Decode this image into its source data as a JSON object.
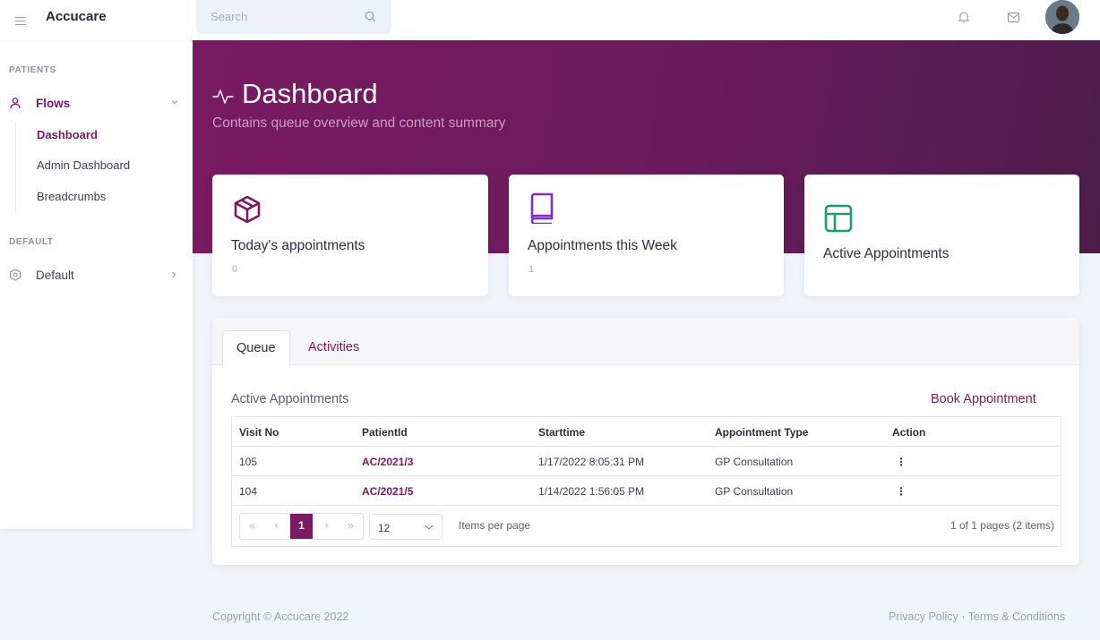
{
  "header": {
    "brand": "Accucare",
    "search_placeholder": "Search"
  },
  "sidebar": {
    "sections": [
      {
        "title": "PATIENTS",
        "item": {
          "label": "Flows",
          "icon": "user-icon"
        },
        "sub_items": [
          "Dashboard",
          "Admin Dashboard",
          "Breadcrumbs"
        ]
      },
      {
        "title": "DEFAULT",
        "item": {
          "label": "Default",
          "icon": "dashboard-icon"
        }
      }
    ]
  },
  "hero": {
    "title": "Dashboard",
    "subtitle": "Contains queue overview and content summary"
  },
  "cards": [
    {
      "title": "Today's appointments",
      "value": "0",
      "icon": "box-icon"
    },
    {
      "title": "Appointments this Week",
      "value": "1",
      "icon": "book-icon"
    },
    {
      "title": "Active Appointments",
      "value": "",
      "icon": "layout-icon"
    }
  ],
  "panel": {
    "tabs": [
      "Queue",
      "Activities"
    ],
    "section_title": "Active Appointments",
    "book_link": "Book Appointment",
    "table": {
      "columns": [
        "Visit No",
        "PatientId",
        "Starttime",
        "Appointment Type",
        "Action"
      ],
      "rows": [
        [
          "105",
          "AC/2021/3",
          "1/17/2022 8:05:31 PM",
          "GP Consultation",
          "⋮"
        ],
        [
          "104",
          "AC/2021/5",
          "1/14/2022 1:56:05 PM",
          "GP Consultation",
          "⋮"
        ]
      ]
    },
    "pager": {
      "first": "«",
      "prev": "‹",
      "current": "1",
      "next": "›",
      "last": "»",
      "page_size": "12",
      "items_per_page_label": "Items per page",
      "info": "1 of 1 pages (2 items)"
    }
  },
  "footer": {
    "copyright": "Copyright © Accucare 2022",
    "privacy": "Privacy Policy",
    "separator": "·",
    "terms": "Terms & Conditions"
  },
  "colors": {
    "brand_primary": "#7a1a62",
    "card_icon_box": "#7a1a62",
    "card_icon_book": "#7b2fc9",
    "card_icon_layout": "#19a06a"
  }
}
